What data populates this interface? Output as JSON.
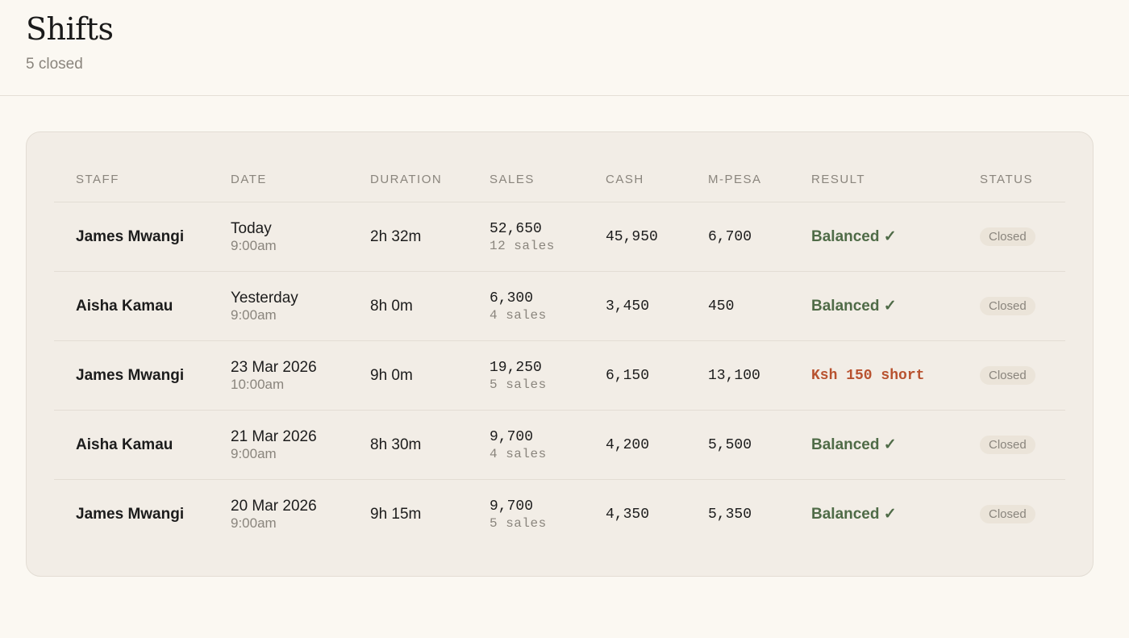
{
  "header": {
    "title": "Shifts",
    "subtitle": "5 closed"
  },
  "table": {
    "columns": [
      "STAFF",
      "DATE",
      "DURATION",
      "SALES",
      "CASH",
      "M-PESA",
      "RESULT",
      "STATUS"
    ],
    "rows": [
      {
        "staff": "James Mwangi",
        "date": "Today",
        "time": "9:00am",
        "duration": "2h 32m",
        "sales_amount": "52,650",
        "sales_count": "12 sales",
        "cash": "45,950",
        "mpesa": "6,700",
        "result": "Balanced ✓",
        "result_type": "balanced",
        "status": "Closed"
      },
      {
        "staff": "Aisha Kamau",
        "date": "Yesterday",
        "time": "9:00am",
        "duration": "8h 0m",
        "sales_amount": "6,300",
        "sales_count": "4 sales",
        "cash": "3,450",
        "mpesa": "450",
        "result": "Balanced ✓",
        "result_type": "balanced",
        "status": "Closed"
      },
      {
        "staff": "James Mwangi",
        "date": "23 Mar 2026",
        "time": "10:00am",
        "duration": "9h 0m",
        "sales_amount": "19,250",
        "sales_count": "5 sales",
        "cash": "6,150",
        "mpesa": "13,100",
        "result": "Ksh 150 short",
        "result_type": "short",
        "status": "Closed"
      },
      {
        "staff": "Aisha Kamau",
        "date": "21 Mar 2026",
        "time": "9:00am",
        "duration": "8h 30m",
        "sales_amount": "9,700",
        "sales_count": "4 sales",
        "cash": "4,200",
        "mpesa": "5,500",
        "result": "Balanced ✓",
        "result_type": "balanced",
        "status": "Closed"
      },
      {
        "staff": "James Mwangi",
        "date": "20 Mar 2026",
        "time": "9:00am",
        "duration": "9h 15m",
        "sales_amount": "9,700",
        "sales_count": "5 sales",
        "cash": "4,350",
        "mpesa": "5,350",
        "result": "Balanced ✓",
        "result_type": "balanced",
        "status": "Closed"
      }
    ]
  },
  "colors": {
    "background": "#fbf8f2",
    "card": "#f2ede6",
    "balanced": "#4f6b47",
    "short": "#b8522f",
    "muted": "#8a857d"
  }
}
